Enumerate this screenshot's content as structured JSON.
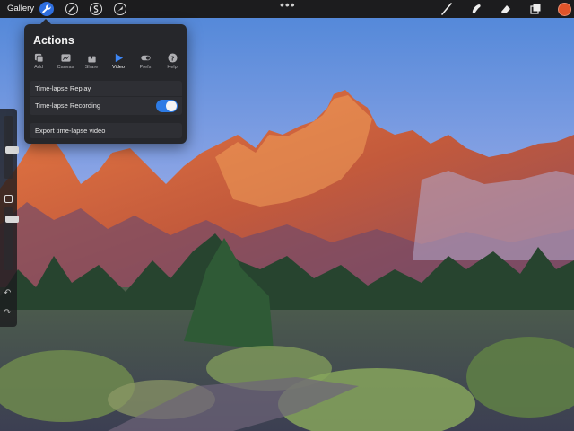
{
  "toolbar": {
    "gallery_label": "Gallery",
    "more_label": "•••",
    "current_color": "#e0542a",
    "accent": "#2f6fe0",
    "left_icons": [
      "wrench-icon",
      "magic-wand-icon",
      "selection-icon",
      "cursor-arrow-icon"
    ],
    "right_icons": [
      "brush-icon",
      "smudge-icon",
      "eraser-icon",
      "layers-icon"
    ]
  },
  "sidebar": {
    "brush_size": 0.45,
    "brush_opacity": 0.15,
    "icons": [
      "modify-square-icon",
      "undo-icon",
      "redo-icon"
    ]
  },
  "actions": {
    "title": "Actions",
    "tabs": [
      {
        "label": "Add",
        "icon": "add-image-icon"
      },
      {
        "label": "Canvas",
        "icon": "canvas-icon"
      },
      {
        "label": "Share",
        "icon": "share-icon"
      },
      {
        "label": "Video",
        "icon": "play-icon",
        "active": true
      },
      {
        "label": "Prefs",
        "icon": "toggle-icon"
      },
      {
        "label": "Help",
        "icon": "question-icon"
      }
    ],
    "replay_label": "Time-lapse Replay",
    "recording_label": "Time-lapse Recording",
    "recording_on": true,
    "export_label": "Export time-lapse video"
  }
}
